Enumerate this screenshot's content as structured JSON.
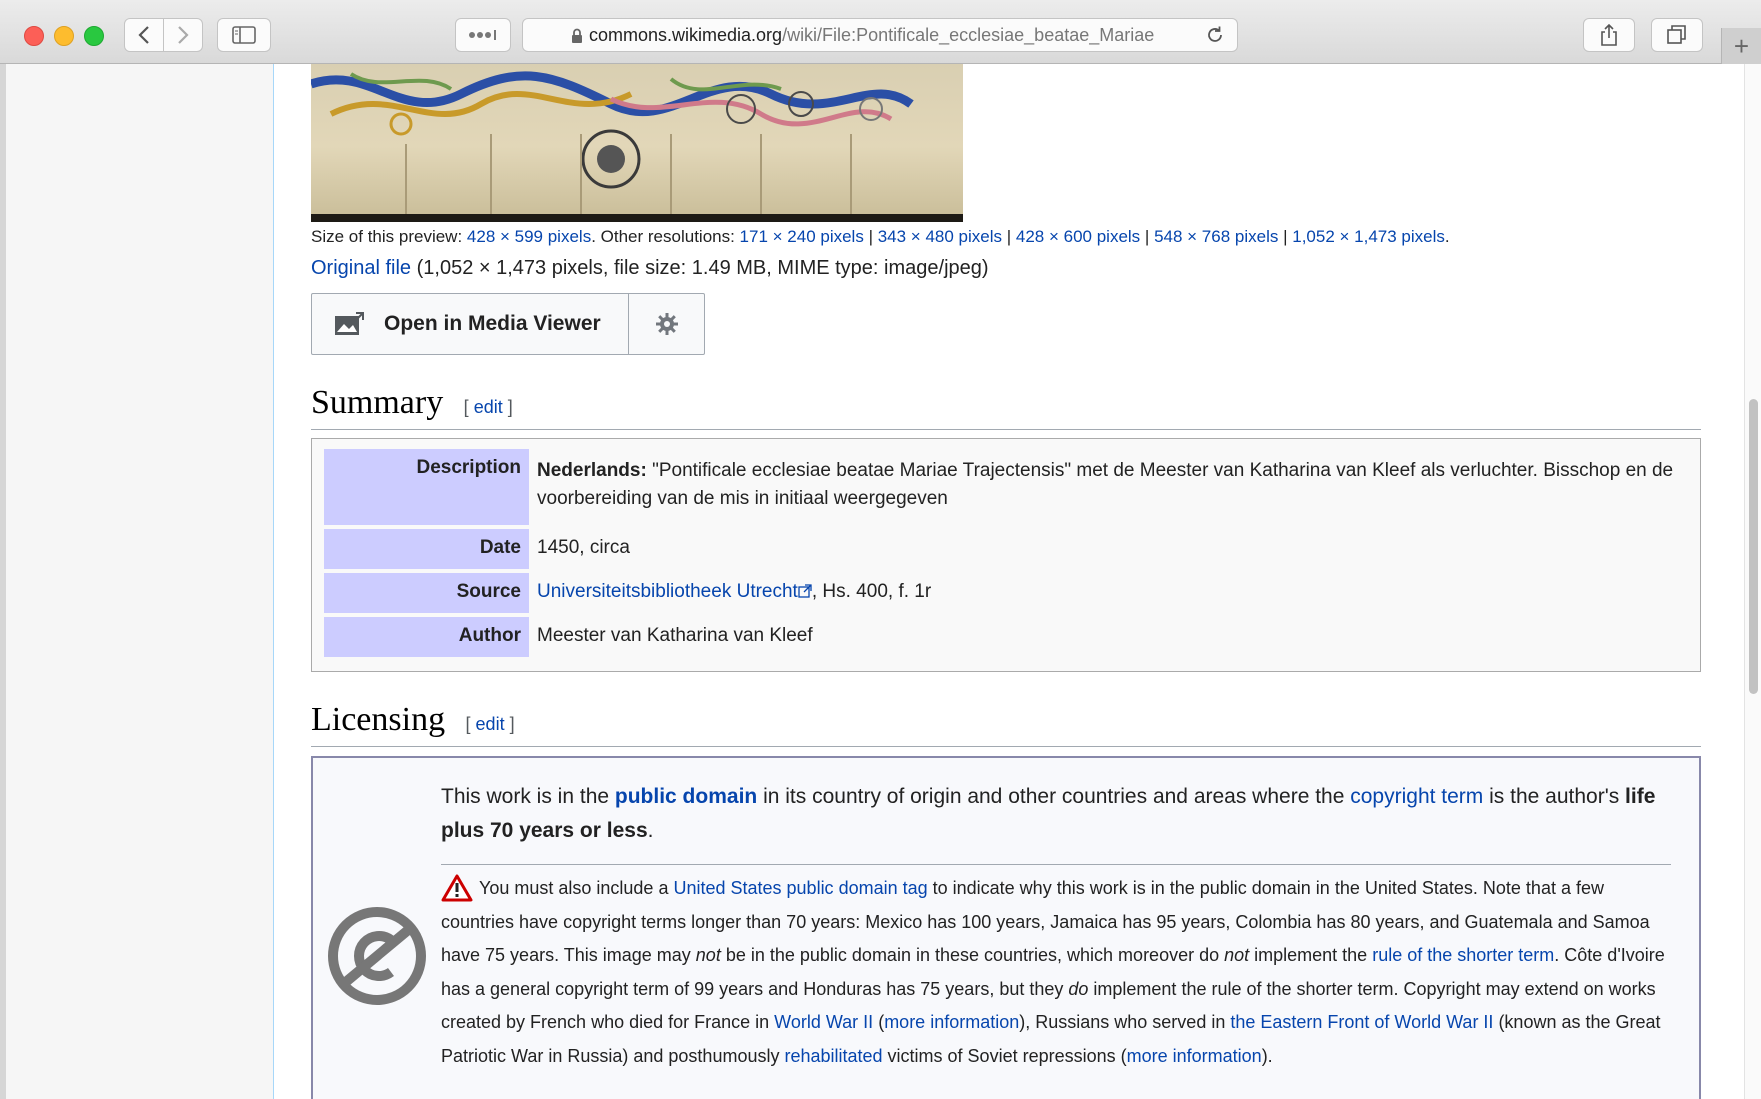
{
  "browser": {
    "url_host": "commons.wikimedia.org",
    "url_path": "/wiki/File:Pontificale_ecclesiae_beatae_Mariae",
    "new_tab_label": "+"
  },
  "preview": {
    "size_prefix": "Size of this preview: ",
    "size_link": "428 × 599 pixels",
    "other_prefix": ". Other resolutions: ",
    "resolutions": [
      "171 × 240 pixels",
      "343 × 480 pixels",
      "428 × 600 pixels",
      "548 × 768 pixels",
      "1,052 × 1,473 pixels"
    ],
    "separator": " | ",
    "end": ".",
    "original_link": "Original file",
    "original_info": " (1,052 × 1,473 pixels, file size: 1.49 MB, MIME type: image/jpeg)"
  },
  "media_viewer": {
    "button_label": "Open in Media Viewer"
  },
  "summary": {
    "heading": "Summary",
    "edit_open": "[ ",
    "edit_label": "edit",
    "edit_close": " ]",
    "rows": {
      "description": {
        "label": "Description",
        "lang": "Nederlands:",
        "text": " \"Pontificale ecclesiae beatae Mariae Trajectensis\" met de Meester van Katharina van Kleef als verluchter. Bisschop en de voorbereiding van de mis in initiaal weergegeven"
      },
      "date": {
        "label": "Date",
        "value": "1450, circa"
      },
      "source": {
        "label": "Source",
        "link": "Universiteitsbibliotheek Utrecht",
        "rest": ", Hs. 400, f. 1r"
      },
      "author": {
        "label": "Author",
        "value": "Meester van Katharina van Kleef"
      }
    }
  },
  "licensing": {
    "heading": "Licensing",
    "edit_label": "edit",
    "p1": {
      "a": "This work is in the ",
      "public_domain": "public domain",
      "b": " in its country of origin and other countries and areas where the ",
      "copyright_term": "copyright term",
      "c": " is the author's ",
      "bold": "life plus 70 years or less",
      "d": "."
    },
    "p2": {
      "a": "You must also include a ",
      "us_tag": "United States public domain tag",
      "b": " to indicate why this work is in the public domain in the United States. Note that a few countries have copyright terms longer than 70 years: Mexico has 100 years, Jamaica has 95 years, Colombia has 80 years, and Guatemala and Samoa have 75 years. This image may ",
      "not1": "not",
      "c": " be in the public domain in these countries, which moreover do ",
      "not2": "not",
      "d": " implement the ",
      "shorter_term": "rule of the shorter term",
      "e": ". Côte d'Ivoire has a general copyright term of 99 years and Honduras has 75 years, but they ",
      "do": "do",
      "f": " implement the rule of the shorter term. Copyright may extend on works created by French who died for France in ",
      "ww2": "World War II",
      "g": " (",
      "more_info1": "more information",
      "h": "), Russians who served in ",
      "eastern_front": "the Eastern Front of World War II",
      "i": " (known as the Great Patriotic War in Russia) and posthumously ",
      "rehabilitated": "rehabilitated",
      "j": " victims of Soviet repressions (",
      "more_info2": "more information",
      "k": ")."
    }
  },
  "icons": [
    "back-icon",
    "forward-icon",
    "sidebar-icon",
    "reader-icon",
    "lock-icon",
    "reload-icon",
    "share-icon",
    "tabs-icon",
    "media-viewer-icon",
    "gear-icon",
    "external-link-icon",
    "warning-icon",
    "public-domain-icon"
  ]
}
